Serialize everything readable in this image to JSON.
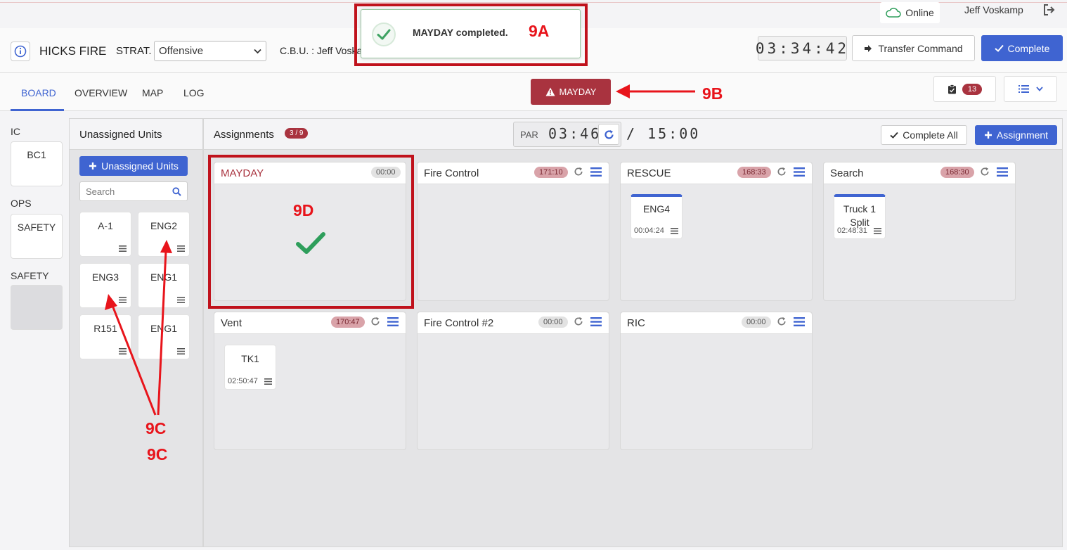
{
  "topbar": {
    "status": "Online",
    "user": "Jeff Voskamp"
  },
  "header": {
    "incident": "HICKS FIRE",
    "strat_label": "STRAT.",
    "strategy": "Offensive",
    "cbu": "C.B.U. : Jeff Voska",
    "clock": "03:34:42",
    "transfer_label": "Transfer Command",
    "complete_label": "Complete"
  },
  "toast": {
    "message": "MAYDAY completed."
  },
  "tabs": [
    {
      "label": "BOARD",
      "active": true
    },
    {
      "label": "OVERVIEW"
    },
    {
      "label": "MAP"
    },
    {
      "label": "LOG"
    }
  ],
  "mayday_button": "MAYDAY",
  "notifications_count": "13",
  "left_roles": [
    {
      "label": "IC",
      "unit": "BC1"
    },
    {
      "label": "OPS",
      "unit": "SAFETY"
    },
    {
      "label": "SAFETY",
      "unit": ""
    }
  ],
  "unassigned": {
    "title": "Unassigned Units",
    "add_label": "Unassigned Units",
    "search_placeholder": "Search",
    "units": [
      "A-1",
      "ENG2",
      "ENG3",
      "ENG1",
      "R151",
      "ENG1"
    ]
  },
  "assignments": {
    "title": "Assignments",
    "count": "3 / 9",
    "par_label": "PAR",
    "par_time": "03:46",
    "par_total": "/ 15:00",
    "complete_all_label": "Complete All",
    "add_label": "Assignment",
    "groups": [
      {
        "title": "MAYDAY",
        "timer": "00:00",
        "units": []
      },
      {
        "title": "Fire Control",
        "timer": "171:10",
        "units": []
      },
      {
        "title": "RESCUE",
        "timer": "168:33",
        "units": [
          {
            "name": "ENG4",
            "time": "00:04:24"
          }
        ]
      },
      {
        "title": "Search",
        "timer": "168:30",
        "units": [
          {
            "name": "Truck 1 Split",
            "time": "02:48:31"
          }
        ]
      },
      {
        "title": "Vent",
        "timer": "170:47",
        "units": [
          {
            "name": "TK1",
            "time": "02:50:47"
          }
        ]
      },
      {
        "title": "Fire Control #2",
        "timer": "00:00",
        "units": []
      },
      {
        "title": "RIC",
        "timer": "00:00",
        "units": []
      }
    ]
  },
  "annotations": {
    "a": "9A",
    "b": "9B",
    "c1": "9C",
    "c2": "9C",
    "d": "9D"
  },
  "colors": {
    "primary": "#3f64d1",
    "mayday": "#a9333f",
    "annotation": "#e8141b",
    "success": "#2e9e5b"
  }
}
